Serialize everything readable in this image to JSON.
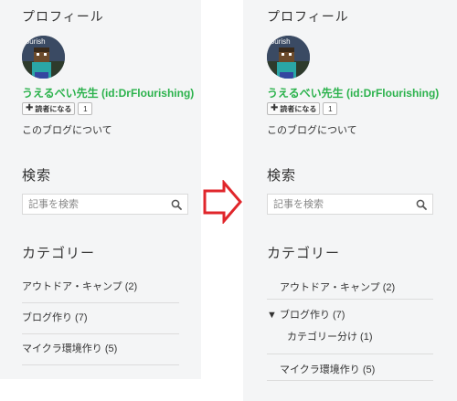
{
  "profile": {
    "section_title": "プロフィール",
    "avatar_text": "lourish",
    "name": "うえるべい先生 (id:DrFlourishing)",
    "reader_button_label": "読者になる",
    "reader_count": "1",
    "about_link": "このブログについて"
  },
  "search": {
    "section_title": "検索",
    "placeholder": "記事を検索"
  },
  "category": {
    "section_title": "カテゴリー",
    "before_items": [
      "アウトドア・キャンプ (2)",
      "ブログ作り (7)",
      "マイクラ環境作り (5)"
    ],
    "after": {
      "item1": "アウトドア・キャンプ (2)",
      "item2": "▼ ブログ作り (7)",
      "sub_item": "カテゴリー分け (1)",
      "item3": "マイクラ環境作り (5)"
    }
  },
  "colors": {
    "accent_green": "#2bb24c",
    "arrow_red": "#e0262b",
    "panel_bg": "#f4f5f6"
  },
  "icons": [
    "search-icon",
    "right-arrow-icon",
    "plus-icon"
  ]
}
